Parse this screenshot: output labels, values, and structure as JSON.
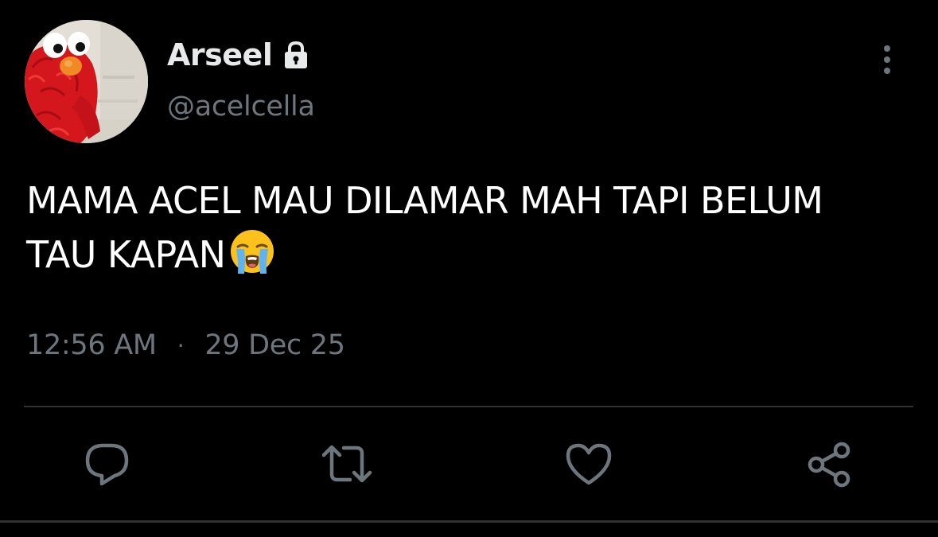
{
  "user": {
    "display_name": "Arseel",
    "handle": "@acelcella",
    "protected": true,
    "avatar_icon": "elmo-avatar"
  },
  "tweet": {
    "text_line1": "MAMA ACEL MAU DILAMAR MAH TAPI BELUM",
    "text_line2": "TAU KAPAN",
    "emoji": "loudly-crying-face",
    "time": "12:56 AM",
    "separator": "·",
    "date": "29 Dec 25"
  },
  "actions": [
    {
      "name": "reply",
      "icon": "reply-icon"
    },
    {
      "name": "retweet",
      "icon": "retweet-icon"
    },
    {
      "name": "like",
      "icon": "heart-icon"
    },
    {
      "name": "share",
      "icon": "share-icon"
    }
  ],
  "colors": {
    "background": "#000000",
    "primary_text": "#e7e9ea",
    "secondary_text": "#6e767d",
    "divider": "#2f3336",
    "icon": "#6e767d"
  }
}
